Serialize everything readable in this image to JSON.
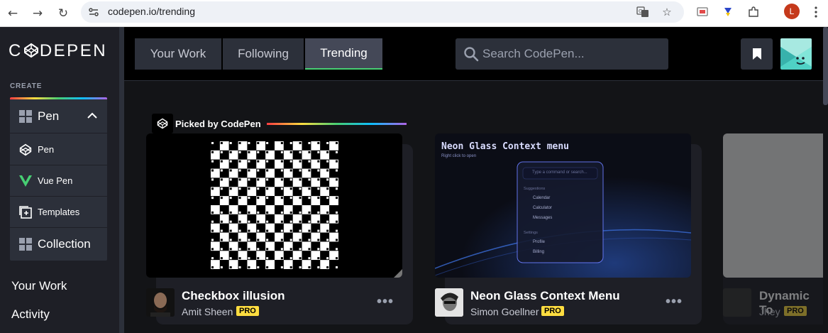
{
  "browser": {
    "url": "codepen.io/trending",
    "profile_initial": "L"
  },
  "logo": "CODEPEN",
  "sidebar": {
    "create_label": "CREATE",
    "create_items": [
      {
        "label": "Pen",
        "icon": "grid-icon"
      },
      {
        "label": "Pen",
        "icon": "codepen-cube-icon"
      },
      {
        "label": "Vue Pen",
        "icon": "vue-icon"
      },
      {
        "label": "Templates",
        "icon": "templates-icon"
      },
      {
        "label": "Collection",
        "icon": "collection-icon"
      }
    ],
    "links": [
      "Your Work",
      "Activity"
    ]
  },
  "header": {
    "tabs": [
      "Your Work",
      "Following",
      "Trending"
    ],
    "active_tab": "Trending",
    "search_placeholder": "Search CodePen..."
  },
  "picked_label": "Picked by CodePen",
  "cards": [
    {
      "title": "Checkbox illusion",
      "author": "Amit Sheen",
      "badge": "PRO"
    },
    {
      "title": "Neon Glass Context Menu",
      "author": "Simon Goellner",
      "badge": "PRO",
      "preview": {
        "heading": "Neon Glass Context menu",
        "subheading": "Right click to open",
        "search_placeholder": "Type a command or search...",
        "section1": "Suggestions",
        "items1": [
          "Calendar",
          "Calculator",
          "Messages"
        ],
        "section2": "Settings",
        "items2": [
          "Profile",
          "Billing"
        ]
      }
    },
    {
      "title": "Dynamic To",
      "author": "Jhey",
      "badge": "PRO"
    }
  ],
  "colors": {
    "accent_green": "#47cf73",
    "pro_yellow": "#ffdd40",
    "sidebar_bg": "#1e1f26",
    "panel_bg": "#2c303a"
  }
}
